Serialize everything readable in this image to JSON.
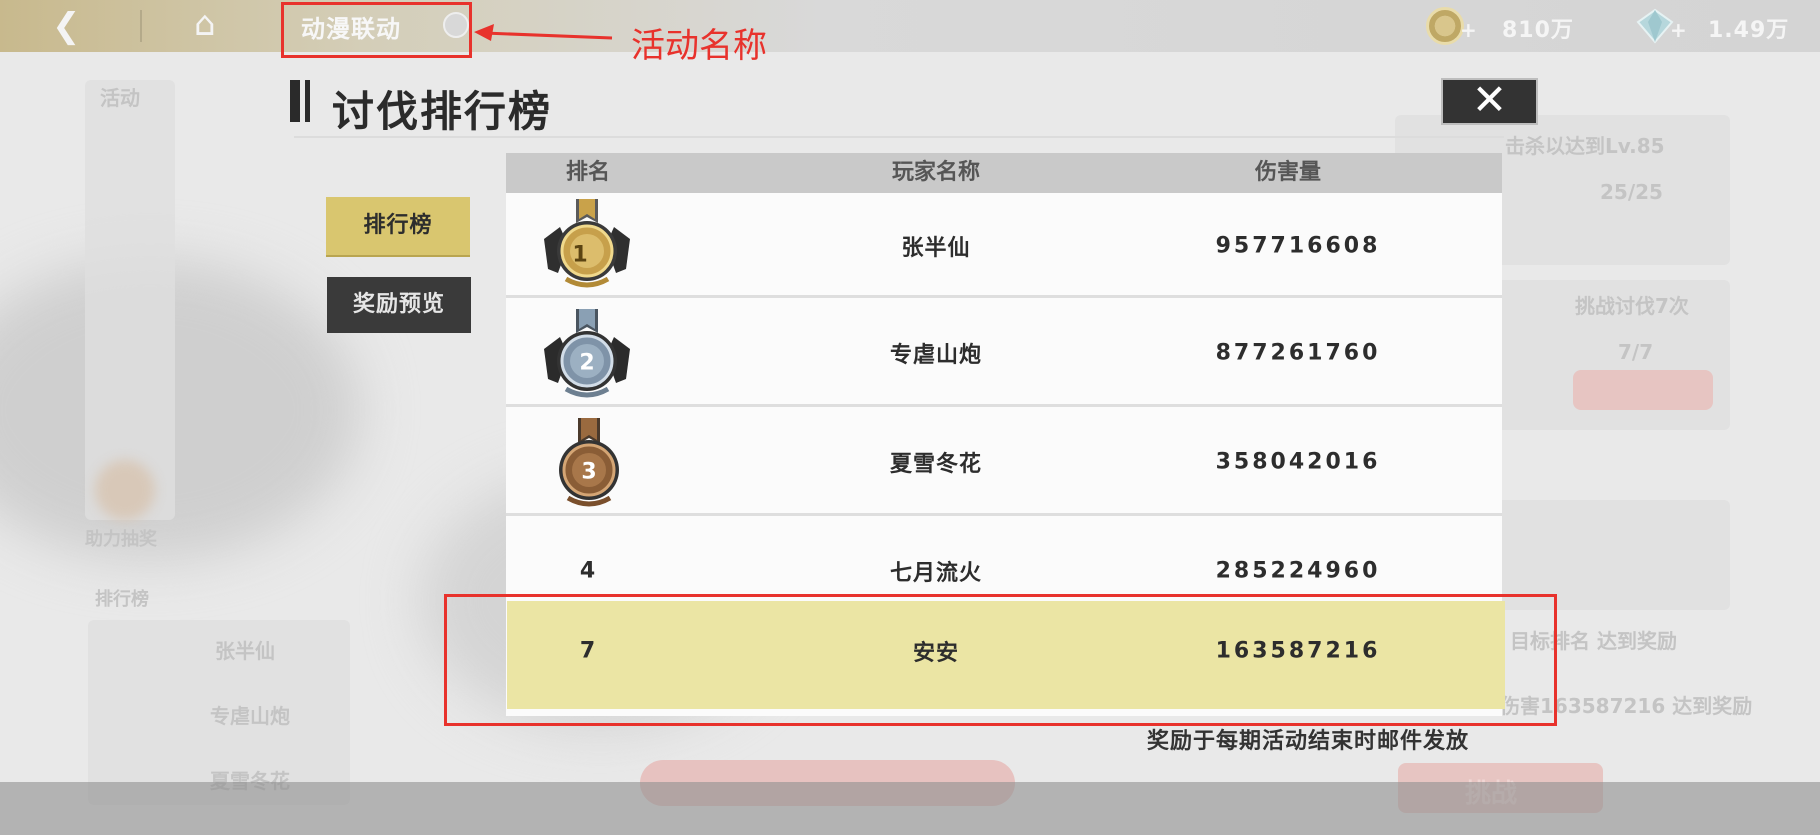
{
  "topbar": {
    "back_icon": "back-arrow-icon",
    "home_icon": "home-icon",
    "event_name": "动漫联动",
    "coins": {
      "icon": "gold-coin-icon",
      "plus": "+",
      "value": "810万"
    },
    "gems": {
      "icon": "diamond-icon",
      "plus": "+",
      "value": "1.49万"
    }
  },
  "annotations": {
    "event_name_label": "活动名称"
  },
  "panel": {
    "title": "讨伐排行榜",
    "close_glyph": "✕",
    "tabs": {
      "rank": "排行榜",
      "reward_preview": "奖励预览"
    },
    "columns": [
      "排名",
      "玩家名称",
      "伤害量"
    ],
    "rows": [
      {
        "rank": "1",
        "medal": "gold-medal-icon",
        "name": "张半仙",
        "damage": "957716608"
      },
      {
        "rank": "2",
        "medal": "silver-medal-icon",
        "name": "专虐山炮",
        "damage": "877261760"
      },
      {
        "rank": "3",
        "medal": "bronze-medal-icon",
        "name": "夏雪冬花",
        "damage": "358042016"
      },
      {
        "rank": "4",
        "name": "七月流火",
        "damage": "285224960"
      }
    ],
    "my_row": {
      "rank": "7",
      "name": "安安",
      "damage": "163587216"
    },
    "reward_note": "奖励于每期活动结束时邮件发放"
  },
  "colors": {
    "highlight_row": "#ebe5a4",
    "active_tab": "#d9c66f",
    "annotation_red": "#e8322c"
  }
}
